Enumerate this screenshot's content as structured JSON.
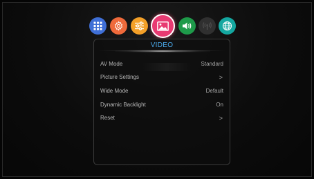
{
  "categories": [
    {
      "icon": "apps-icon",
      "color": "#3f6fd6"
    },
    {
      "icon": "gear-icon",
      "color": "#ef6a3b"
    },
    {
      "icon": "sliders-icon",
      "color": "#f4a028"
    },
    {
      "icon": "picture-icon",
      "color": "#e83a72",
      "selected": true
    },
    {
      "icon": "sound-icon",
      "color": "#1e9a4a"
    },
    {
      "icon": "broadcast-icon",
      "color": "#303030"
    },
    {
      "icon": "globe-icon",
      "color": "#14a7a0"
    }
  ],
  "panel": {
    "title": "VIDEO",
    "rows": [
      {
        "label": "AV Mode",
        "value": "Standard"
      },
      {
        "label": "Picture Settings",
        "value": ">"
      },
      {
        "label": "Wide Mode",
        "value": "Default"
      },
      {
        "label": "Dynamic Backlight",
        "value": "On"
      },
      {
        "label": "Reset",
        "value": ">"
      }
    ]
  },
  "colors": {
    "title": "#4aa8e8",
    "text": "#b8b8b8",
    "background": "#0c0c0c"
  }
}
